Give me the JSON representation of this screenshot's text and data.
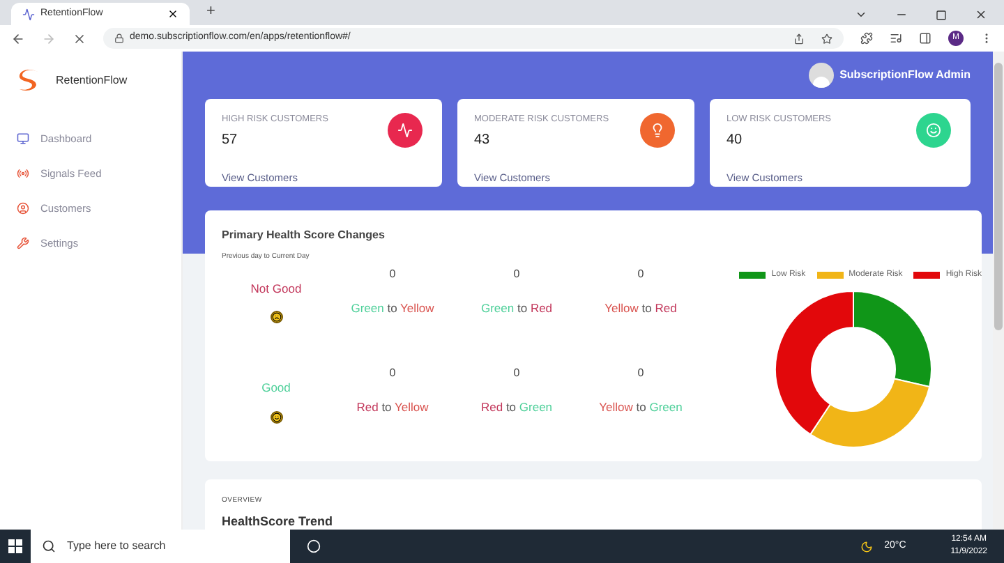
{
  "browser": {
    "tab_title": "RetentionFlow",
    "new_tab": "+",
    "url": "demo.subscriptionflow.com/en/apps/retentionflow#/",
    "avatar": "M"
  },
  "sidebar": {
    "brand": "RetentionFlow",
    "items": [
      {
        "label": "Dashboard",
        "kind": "monitor"
      },
      {
        "label": "Signals Feed",
        "kind": "signal"
      },
      {
        "label": "Customers",
        "kind": "user"
      },
      {
        "label": "Settings",
        "kind": "tools"
      }
    ]
  },
  "header": {
    "user": "SubscriptionFlow Admin"
  },
  "cards": [
    {
      "title": "HIGH RISK CUSTOMERS",
      "value": "57",
      "link": "View Customers",
      "kind": "pulse",
      "color": "#e8284f"
    },
    {
      "title": "MODERATE RISK CUSTOMERS",
      "value": "43",
      "link": "View Customers",
      "kind": "bulb",
      "color": "#f0672f"
    },
    {
      "title": "LOW RISK CUSTOMERS",
      "value": "40",
      "link": "View Customers",
      "kind": "smile",
      "color": "#2dd58f"
    }
  ],
  "health": {
    "title": "Primary Health Score Changes",
    "subtitle": "Previous day to Current Day",
    "rows": [
      {
        "label": "Not Good",
        "kind": "bad",
        "changes": [
          {
            "count": "0",
            "from": {
              "text": "Green",
              "color": "#4fd09a"
            },
            "to": "to",
            "target": {
              "text": "Yellow",
              "color": "#d9534f"
            }
          },
          {
            "count": "0",
            "from": {
              "text": "Green",
              "color": "#4fd09a"
            },
            "to": "to",
            "target": {
              "text": "Red",
              "color": "#c2365a"
            }
          },
          {
            "count": "0",
            "from": {
              "text": "Yellow",
              "color": "#d9534f"
            },
            "to": "to",
            "target": {
              "text": "Red",
              "color": "#c2365a"
            }
          }
        ]
      },
      {
        "label": "Good",
        "kind": "good",
        "changes": [
          {
            "count": "0",
            "from": {
              "text": "Red",
              "color": "#c2365a"
            },
            "to": "to",
            "target": {
              "text": "Yellow",
              "color": "#d9534f"
            }
          },
          {
            "count": "0",
            "from": {
              "text": "Red",
              "color": "#c2365a"
            },
            "to": "to",
            "target": {
              "text": "Green",
              "color": "#4fd09a"
            }
          },
          {
            "count": "0",
            "from": {
              "text": "Yellow",
              "color": "#d9534f"
            },
            "to": "to",
            "target": {
              "text": "Green",
              "color": "#4fd09a"
            }
          }
        ]
      }
    ],
    "chart_data": {
      "type": "donut",
      "legend": "top",
      "categories": [
        "Low Risk",
        "Moderate Risk",
        "High Risk"
      ],
      "series": [
        {
          "values": [
            28.6,
            30.7,
            40.7
          ]
        }
      ],
      "colors": [
        "#109618",
        "#f1b517",
        "#e2080b"
      ]
    }
  },
  "overview": {
    "eyebrow": "OVERVIEW",
    "title": "HealthScore Trend"
  },
  "taskbar": {
    "search_placeholder": "Type here to search",
    "weather": "20°C",
    "time": "12:54 AM",
    "date": "11/9/2022"
  }
}
